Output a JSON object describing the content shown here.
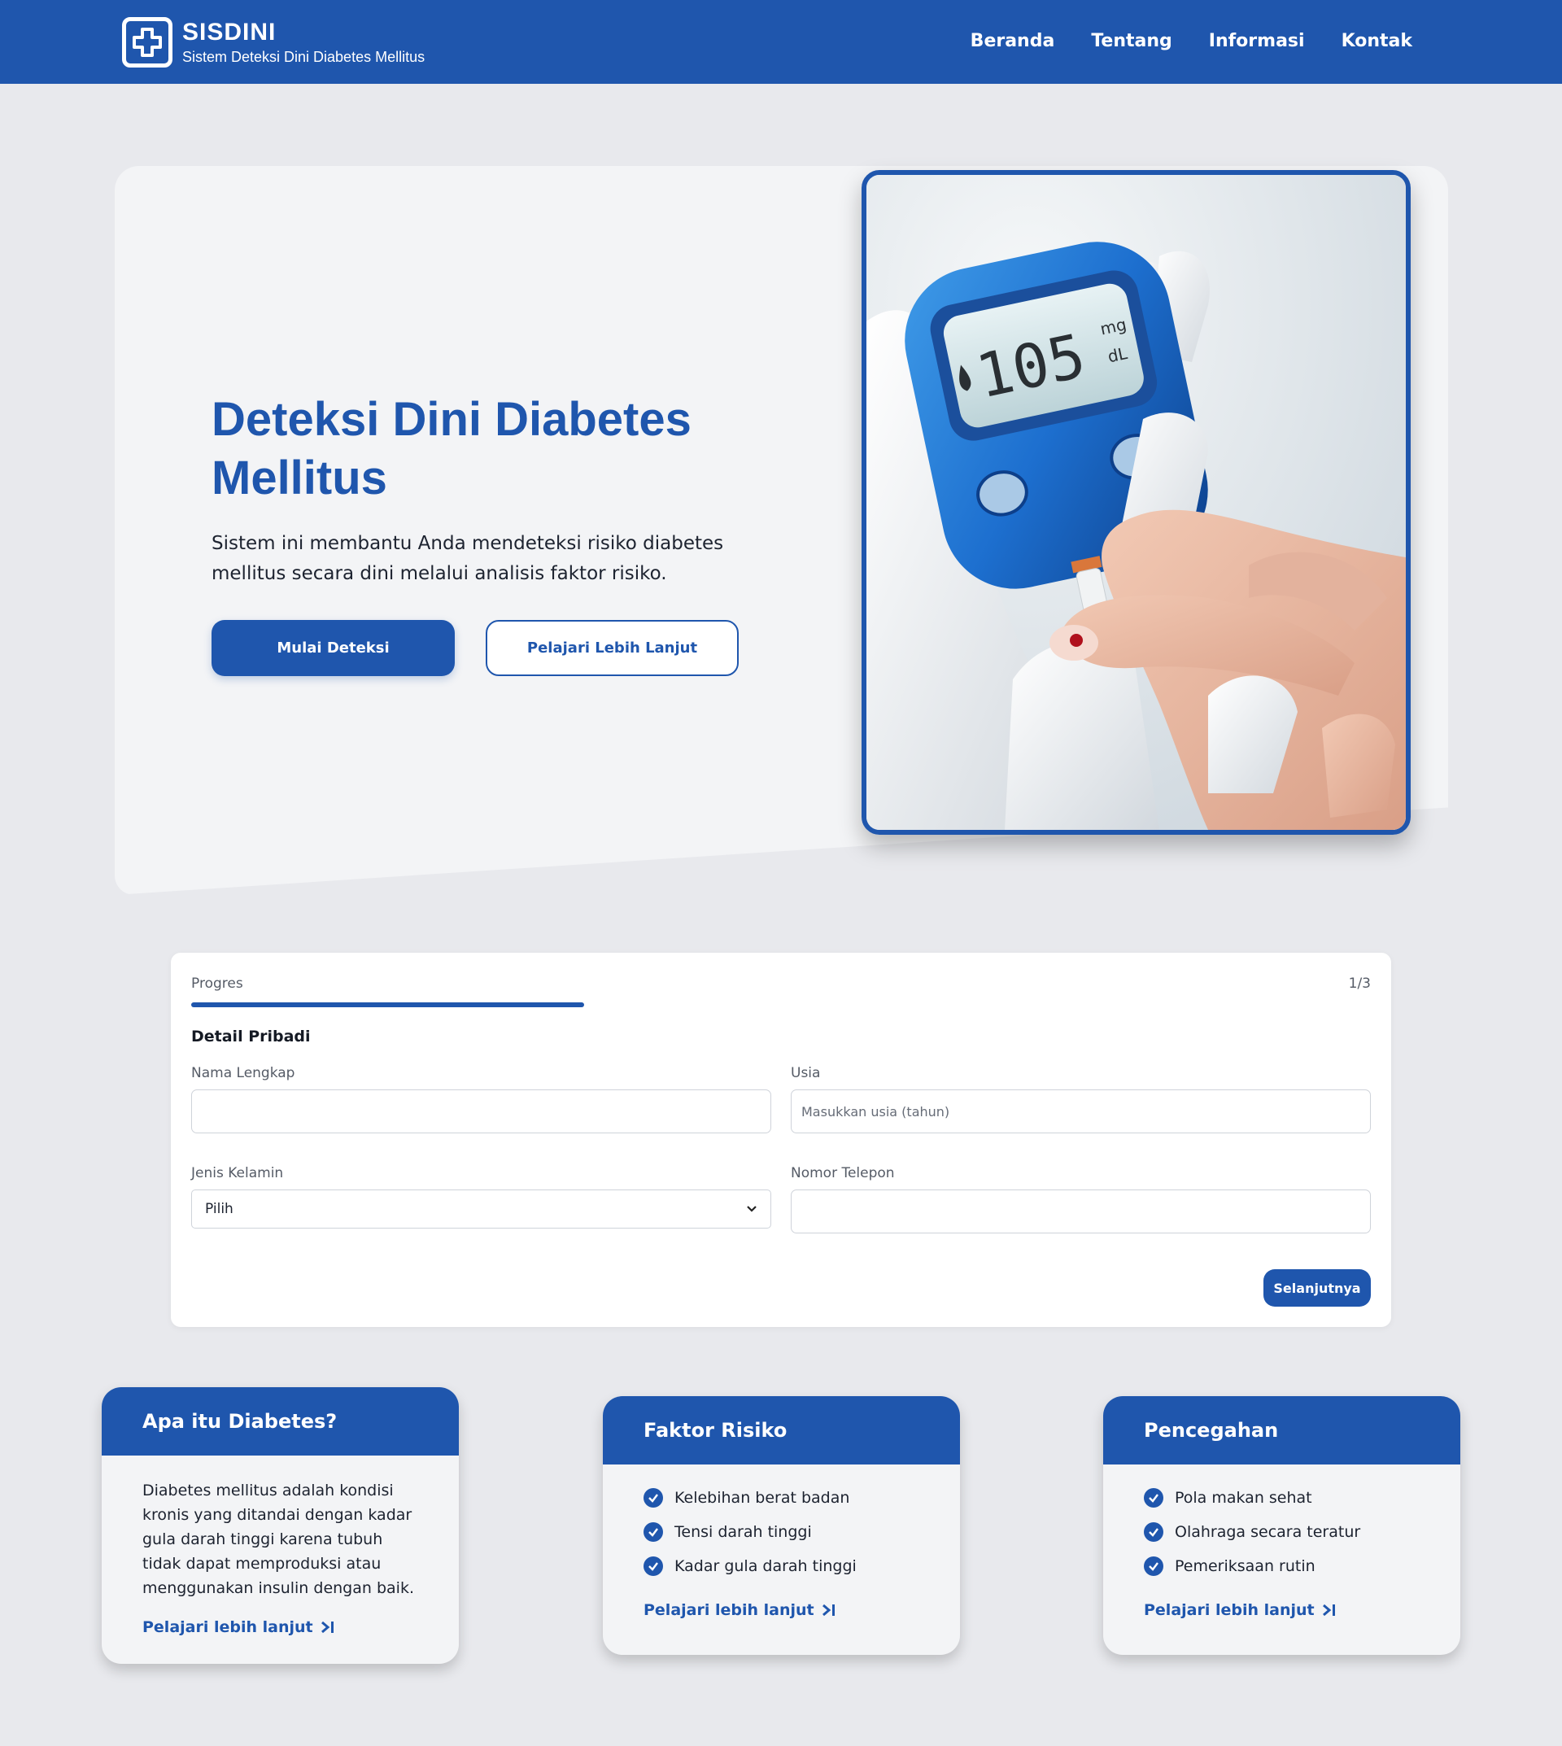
{
  "brand": {
    "title": "SISDINI",
    "subtitle": "Sistem Deteksi Dini Diabetes Mellitus",
    "logo_icon": "medical-cross-icon"
  },
  "nav": {
    "items": [
      {
        "label": "Beranda"
      },
      {
        "label": "Tentang"
      },
      {
        "label": "Informasi"
      },
      {
        "label": "Kontak"
      }
    ]
  },
  "hero": {
    "title": "Deteksi Dini Diabetes Mellitus",
    "description": "Sistem ini membantu Anda mendeteksi risiko diabetes mellitus secara dini melalui analisis faktor risiko.",
    "primary_button": "Mulai Deteksi",
    "secondary_button": "Pelajari Lebih Lanjut",
    "image": {
      "meter_value": "105",
      "meter_unit_top": "mg",
      "meter_unit_bottom": "dL"
    }
  },
  "form": {
    "progress_label": "Progres",
    "progress_count": "1/3",
    "progress_fraction": 0.333,
    "section_title": "Detail Pribadi",
    "fields": {
      "full_name": {
        "label": "Nama Lengkap",
        "value": "",
        "placeholder": ""
      },
      "age": {
        "label": "Usia",
        "value": "",
        "placeholder": "Masukkan usia (tahun)"
      },
      "gender": {
        "label": "Jenis Kelamin",
        "selected": "Pilih"
      },
      "phone": {
        "label": "Nomor Telepon",
        "value": "",
        "placeholder": ""
      }
    },
    "next_button": "Selanjutnya"
  },
  "cards": {
    "what": {
      "title": "Apa itu Diabetes?",
      "text": "Diabetes mellitus adalah kondisi kronis yang ditandai dengan kadar gula darah tinggi karena tubuh tidak dapat memproduksi atau menggunakan insulin dengan baik.",
      "link": "Pelajari lebih lanjut"
    },
    "risk": {
      "title": "Faktor Risiko",
      "items": [
        "Kelebihan berat badan",
        "Tensi darah tinggi",
        "Kadar gula darah tinggi"
      ],
      "link": "Pelajari lebih lanjut"
    },
    "prevention": {
      "title": "Pencegahan",
      "items": [
        "Pola makan sehat",
        "Olahraga secara teratur",
        "Pemeriksaan rutin"
      ],
      "link": "Pelajari lebih lanjut"
    }
  },
  "colors": {
    "primary": "#1f56ad",
    "page_bg": "#e8e9ed",
    "panel_bg": "#f3f4f6"
  }
}
